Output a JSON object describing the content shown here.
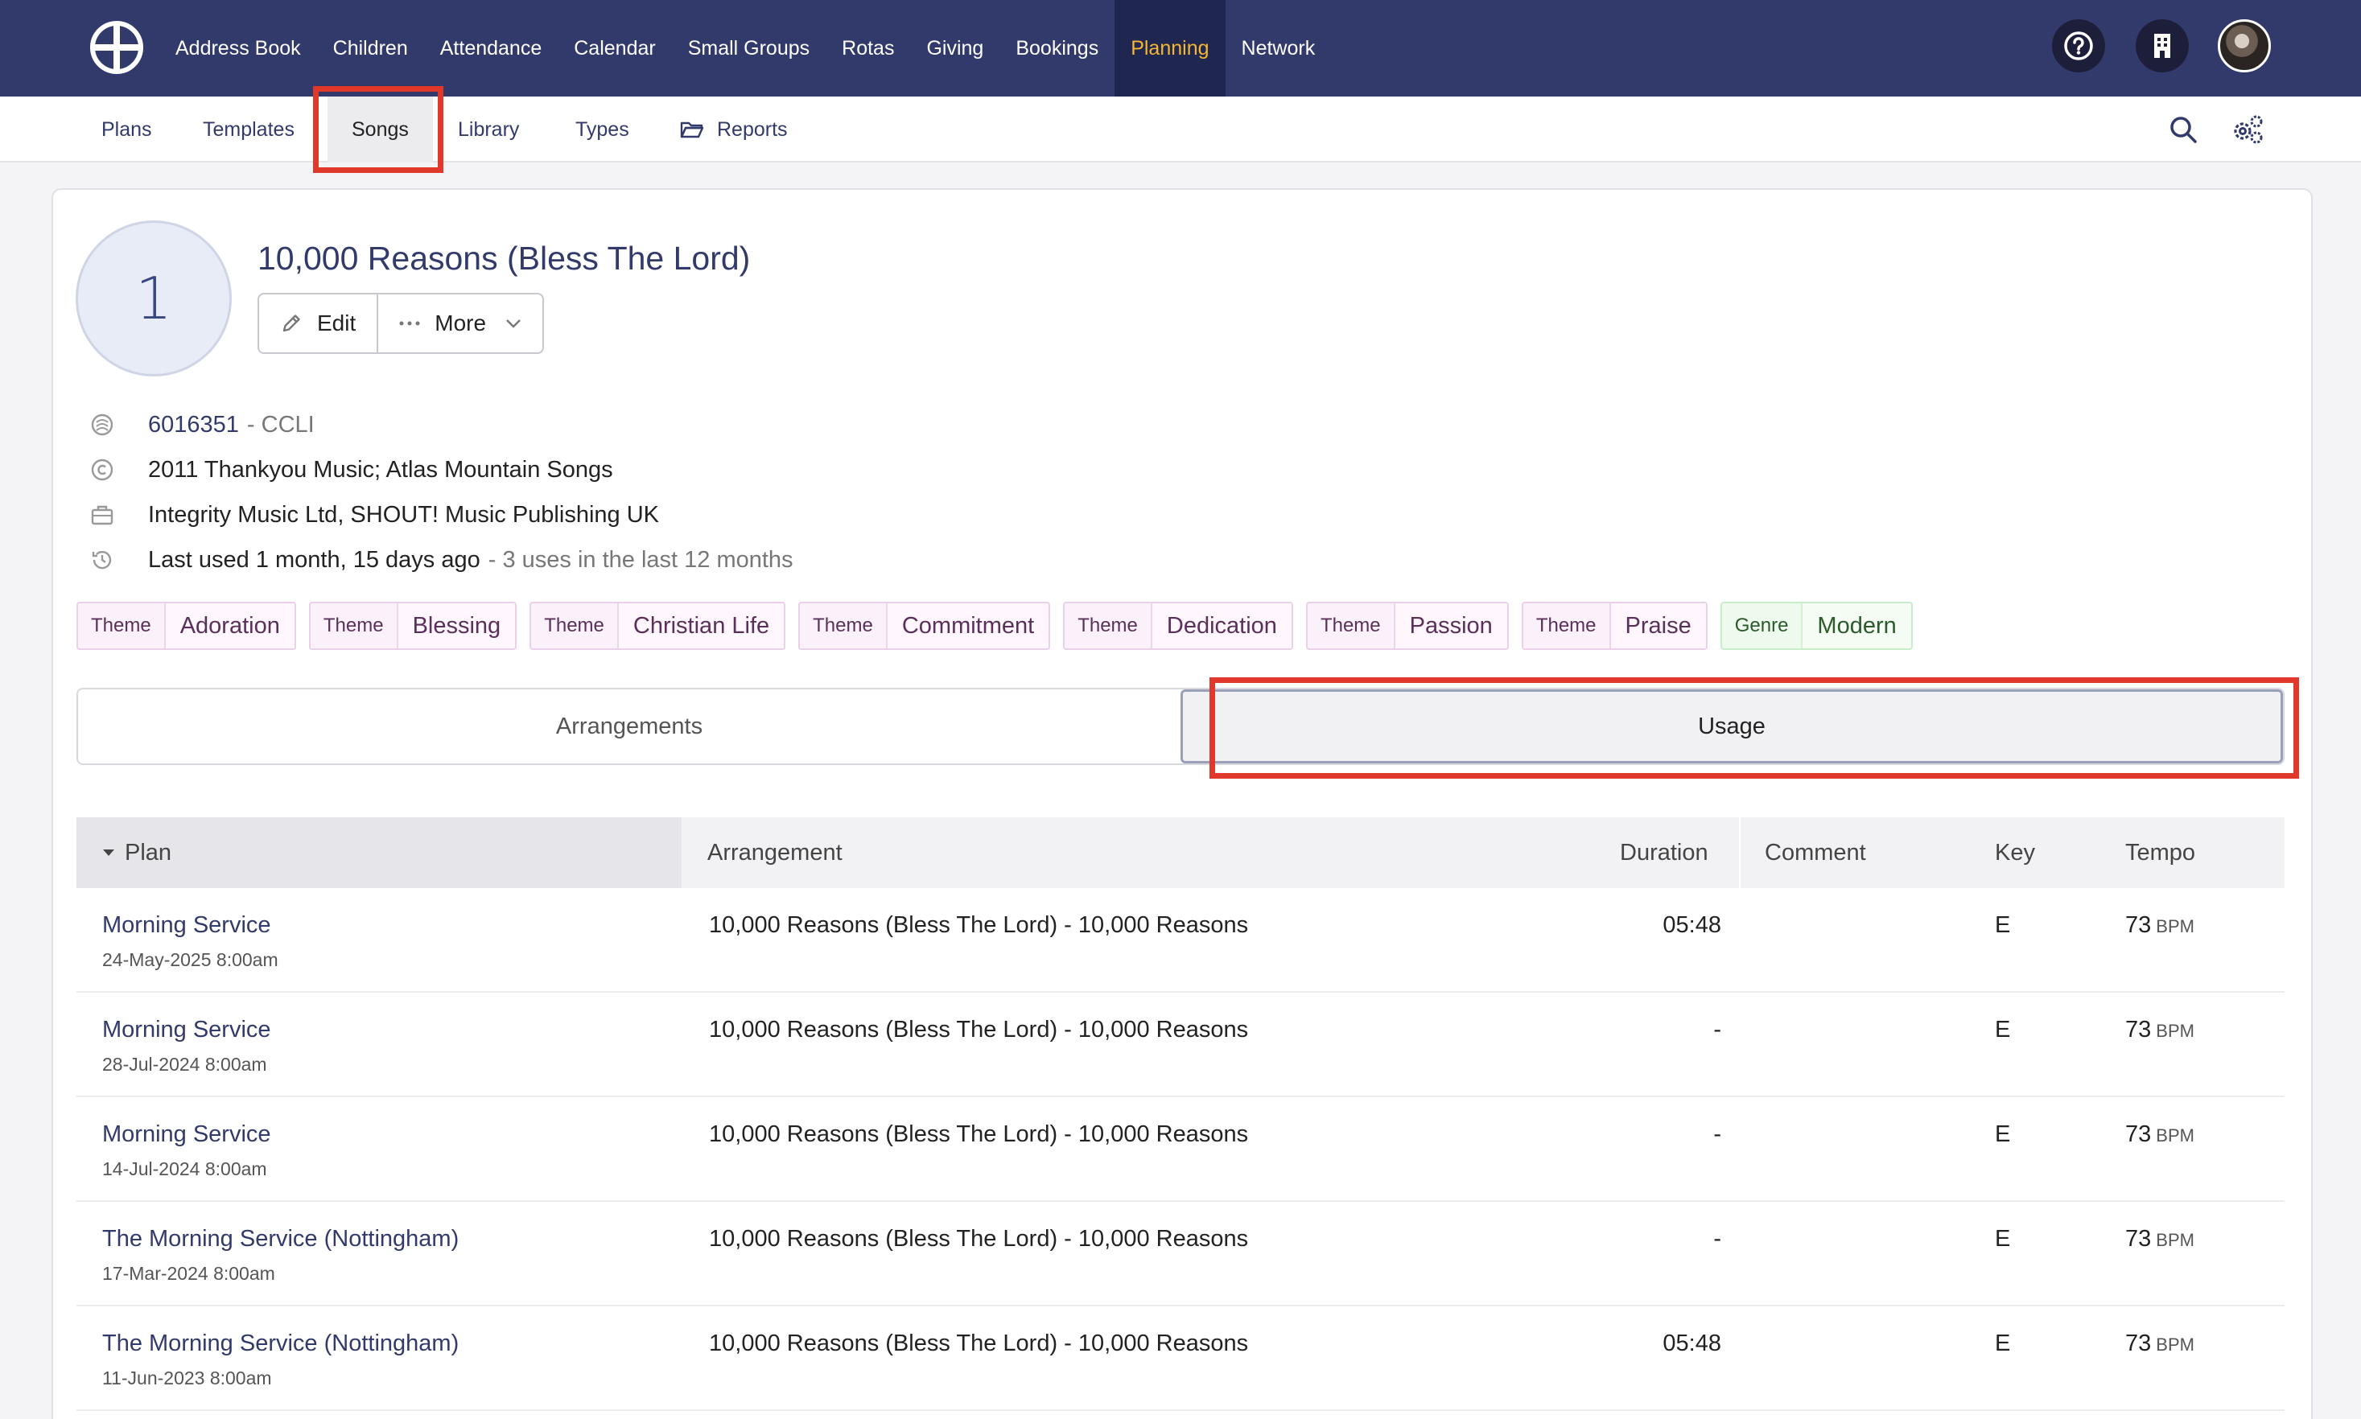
{
  "topnav": {
    "items": [
      {
        "label": "Address Book"
      },
      {
        "label": "Children"
      },
      {
        "label": "Attendance"
      },
      {
        "label": "Calendar"
      },
      {
        "label": "Small Groups"
      },
      {
        "label": "Rotas"
      },
      {
        "label": "Giving"
      },
      {
        "label": "Bookings"
      },
      {
        "label": "Planning",
        "active": true
      },
      {
        "label": "Network"
      }
    ],
    "active_color": "#f5b731",
    "background": "#323a6b"
  },
  "subnav": {
    "plans": "Plans",
    "templates": "Templates",
    "songs": "Songs",
    "library": "Library",
    "types": "Types",
    "reports": "Reports"
  },
  "song": {
    "number": "1",
    "title": "10,000 Reasons (Bless The Lord)",
    "edit_label": "Edit",
    "more_label": "More",
    "ccli_number": "6016351",
    "ccli_suffix": "- CCLI",
    "copyright": "2011 Thankyou Music; Atlas Mountain Songs",
    "publisher": "Integrity Music Ltd, SHOUT! Music Publishing UK",
    "last_used": "Last used 1 month, 15 days ago",
    "uses": "- 3 uses in the last 12 months"
  },
  "tags": [
    {
      "key": "Theme",
      "value": "Adoration"
    },
    {
      "key": "Theme",
      "value": "Blessing"
    },
    {
      "key": "Theme",
      "value": "Christian Life"
    },
    {
      "key": "Theme",
      "value": "Commitment"
    },
    {
      "key": "Theme",
      "value": "Dedication"
    },
    {
      "key": "Theme",
      "value": "Passion"
    },
    {
      "key": "Theme",
      "value": "Praise"
    },
    {
      "key": "Genre",
      "value": "Modern"
    }
  ],
  "tabs": {
    "arrangements": "Arrangements",
    "usage": "Usage"
  },
  "table": {
    "headers": {
      "plan": "Plan",
      "arrangement": "Arrangement",
      "duration": "Duration",
      "comment": "Comment",
      "key": "Key",
      "tempo": "Tempo"
    },
    "bpm_label": "BPM",
    "rows": [
      {
        "plan": "Morning Service",
        "date": "24-May-2025 8:00am",
        "arrangement": "10,000 Reasons (Bless The Lord) - 10,000 Reasons",
        "duration": "05:48",
        "comment": "",
        "key": "E",
        "tempo": "73"
      },
      {
        "plan": "Morning Service",
        "date": "28-Jul-2024 8:00am",
        "arrangement": "10,000 Reasons (Bless The Lord) - 10,000 Reasons",
        "duration": "-",
        "comment": "",
        "key": "E",
        "tempo": "73"
      },
      {
        "plan": "Morning Service",
        "date": "14-Jul-2024 8:00am",
        "arrangement": "10,000 Reasons (Bless The Lord) - 10,000 Reasons",
        "duration": "-",
        "comment": "",
        "key": "E",
        "tempo": "73"
      },
      {
        "plan": "The Morning Service (Nottingham)",
        "date": "17-Mar-2024 8:00am",
        "arrangement": "10,000 Reasons (Bless The Lord) - 10,000 Reasons",
        "duration": "-",
        "comment": "",
        "key": "E",
        "tempo": "73"
      },
      {
        "plan": "The Morning Service (Nottingham)",
        "date": "11-Jun-2023 8:00am",
        "arrangement": "10,000 Reasons (Bless The Lord) - 10,000 Reasons",
        "duration": "05:48",
        "comment": "",
        "key": "E",
        "tempo": "73"
      }
    ]
  },
  "highlight_color": "#e0392b"
}
